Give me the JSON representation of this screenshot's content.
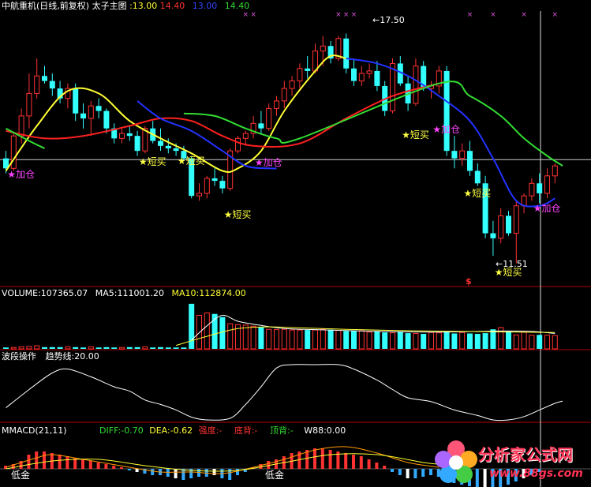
{
  "headers": {
    "main": {
      "title": "中航重机(日线,前复权) 太子主图",
      "v1": ":13.00",
      "v2": "14.40",
      "v3": "13.00",
      "v4": "14.40"
    },
    "volume": {
      "vol": "VOLUME:107365.07",
      "ma5": "MA5:111001.20",
      "ma10": "MA10:112874.00"
    },
    "wave": {
      "name": "波段操作",
      "trend": "趋势线:20.00"
    },
    "macd": {
      "name": "MMACD(21,11)",
      "diff": "DIFF:-0.70",
      "dea": "DEA:-0.62",
      "strength": "强度:-",
      "bottom": "底背:-",
      "top": "顶背:-",
      "w88": "W88:0.00"
    }
  },
  "annotations": {
    "high": "17.50",
    "low": "11.51",
    "low_signal": "低金",
    "s_mark": "$"
  },
  "signals": [
    {
      "label": "加仓",
      "color": "#ff44ff",
      "candle": 1,
      "price": 11.95
    },
    {
      "label": "短买",
      "color": "#ffff44",
      "candle": 18,
      "price": 12.45
    },
    {
      "label": "短买",
      "color": "#ffff44",
      "candle": 23,
      "price": 12.5
    },
    {
      "label": "短买",
      "color": "#ffff44",
      "candle": 29,
      "price": 10.35
    },
    {
      "label": "加仓",
      "color": "#ff44ff",
      "candle": 33,
      "price": 12.42
    },
    {
      "label": "短买",
      "color": "#ffff44",
      "candle": 52,
      "price": 13.55
    },
    {
      "label": "加仓",
      "color": "#ff44ff",
      "candle": 56,
      "price": 13.75
    },
    {
      "label": "短买",
      "color": "#ffff44",
      "candle": 60,
      "price": 11.2
    },
    {
      "label": "短买",
      "color": "#ffff44",
      "candle": 64,
      "price": 8.05
    },
    {
      "label": "加仓",
      "color": "#ff44ff",
      "candle": 69,
      "price": 10.6
    }
  ],
  "watermark": {
    "title": "分析家公式网",
    "url": "www.88gs.com"
  },
  "colors": {
    "up": "#ff3232",
    "down": "#33ffff",
    "ma_short": "#ffff33",
    "ma_mid": "#ff2020",
    "ma_blue": "#2233ff",
    "ma_green": "#33dd33",
    "vol_ma5": "#ffffff",
    "vol_ma10": "#ffff33",
    "panel_border": "#b00000"
  },
  "chart_data": [
    {
      "type": "candlestick",
      "title": "中航重机(日线,前复权) 太子主图",
      "price_range": [
        7.5,
        18.5
      ],
      "reference_line": 12.55,
      "ohlc": [
        [
          12.6,
          12.9,
          12.0,
          12.2
        ],
        [
          12.2,
          13.6,
          12.1,
          13.5
        ],
        [
          13.5,
          14.6,
          13.2,
          14.3
        ],
        [
          14.3,
          16.0,
          13.8,
          15.2
        ],
        [
          15.2,
          16.6,
          15.0,
          15.9
        ],
        [
          15.9,
          16.3,
          15.6,
          15.7
        ],
        [
          15.7,
          16.0,
          15.1,
          15.4
        ],
        [
          15.4,
          15.7,
          14.8,
          15.0
        ],
        [
          15.0,
          15.6,
          14.6,
          15.4
        ],
        [
          15.4,
          15.6,
          14.1,
          14.4
        ],
        [
          14.4,
          14.8,
          13.8,
          14.2
        ],
        [
          14.2,
          14.9,
          13.5,
          14.7
        ],
        [
          14.7,
          15.0,
          14.2,
          14.5
        ],
        [
          14.5,
          14.6,
          13.6,
          13.8
        ],
        [
          13.8,
          14.0,
          13.2,
          13.4
        ],
        [
          13.4,
          13.8,
          13.2,
          13.6
        ],
        [
          13.6,
          13.9,
          13.3,
          13.5
        ],
        [
          13.5,
          13.7,
          12.7,
          12.9
        ],
        [
          12.9,
          13.9,
          12.8,
          13.8
        ],
        [
          13.8,
          14.1,
          13.2,
          13.3
        ],
        [
          13.3,
          13.8,
          12.9,
          13.1
        ],
        [
          13.1,
          13.4,
          12.8,
          13.0
        ],
        [
          13.0,
          13.2,
          12.7,
          12.9
        ],
        [
          12.9,
          13.1,
          12.5,
          12.6
        ],
        [
          12.6,
          12.7,
          11.0,
          11.1
        ],
        [
          11.1,
          11.6,
          10.9,
          11.2
        ],
        [
          11.2,
          11.9,
          11.0,
          11.8
        ],
        [
          11.8,
          12.2,
          11.5,
          11.7
        ],
        [
          11.7,
          11.9,
          11.2,
          11.4
        ],
        [
          11.4,
          13.0,
          11.3,
          12.9
        ],
        [
          12.9,
          13.5,
          12.8,
          13.4
        ],
        [
          13.4,
          13.7,
          13.1,
          13.6
        ],
        [
          13.6,
          14.3,
          13.4,
          14.0
        ],
        [
          14.0,
          14.5,
          13.6,
          13.8
        ],
        [
          13.8,
          14.8,
          13.7,
          14.6
        ],
        [
          14.6,
          15.1,
          14.3,
          14.9
        ],
        [
          14.9,
          15.7,
          14.6,
          15.4
        ],
        [
          15.4,
          15.9,
          15.1,
          15.7
        ],
        [
          15.7,
          16.4,
          15.4,
          16.2
        ],
        [
          16.2,
          16.7,
          15.8,
          16.1
        ],
        [
          16.1,
          17.2,
          16.0,
          16.9
        ],
        [
          16.9,
          17.5,
          16.3,
          17.1
        ],
        [
          17.1,
          17.3,
          16.4,
          16.6
        ],
        [
          16.6,
          17.5,
          16.5,
          17.4
        ],
        [
          17.4,
          17.6,
          16.0,
          16.2
        ],
        [
          16.2,
          16.6,
          15.5,
          15.7
        ],
        [
          15.7,
          16.3,
          15.5,
          16.0
        ],
        [
          16.0,
          16.4,
          15.8,
          16.1
        ],
        [
          16.1,
          16.5,
          15.3,
          15.5
        ],
        [
          15.5,
          15.7,
          14.3,
          14.5
        ],
        [
          14.5,
          16.6,
          14.4,
          16.4
        ],
        [
          16.4,
          16.7,
          15.5,
          15.6
        ],
        [
          15.6,
          15.9,
          14.5,
          14.8
        ],
        [
          14.8,
          16.6,
          14.7,
          16.3
        ],
        [
          16.3,
          16.5,
          15.3,
          15.4
        ],
        [
          15.4,
          15.7,
          15.0,
          15.5
        ],
        [
          15.5,
          16.3,
          15.2,
          16.1
        ],
        [
          16.1,
          16.3,
          12.7,
          12.9
        ],
        [
          12.9,
          13.5,
          12.2,
          12.6
        ],
        [
          12.6,
          13.2,
          12.3,
          12.9
        ],
        [
          12.9,
          13.3,
          11.9,
          12.1
        ],
        [
          12.1,
          12.4,
          11.5,
          11.6
        ],
        [
          11.6,
          11.9,
          9.4,
          9.6
        ],
        [
          9.6,
          10.1,
          8.7,
          9.4
        ],
        [
          9.4,
          10.6,
          9.2,
          10.3
        ],
        [
          10.3,
          10.5,
          9.5,
          9.6
        ],
        [
          9.6,
          10.9,
          8.4,
          10.7
        ],
        [
          10.7,
          11.2,
          10.4,
          11.1
        ],
        [
          11.1,
          11.8,
          10.9,
          11.6
        ],
        [
          11.6,
          12.0,
          10.8,
          11.2
        ],
        [
          11.2,
          12.2,
          11.0,
          11.9
        ],
        [
          11.9,
          12.4,
          11.6,
          12.3
        ]
      ],
      "lines": [
        {
          "color": "#ffff33",
          "points": [
            [
              0,
              12.1
            ],
            [
              4,
              13.9
            ],
            [
              8,
              15.3
            ],
            [
              12,
              15.2
            ],
            [
              16,
              14.1
            ],
            [
              20,
              13.4
            ],
            [
              24,
              12.8
            ],
            [
              28,
              12.1
            ],
            [
              30,
              12.2
            ],
            [
              33,
              12.9
            ],
            [
              36,
              14.5
            ],
            [
              40,
              16.1
            ],
            [
              42,
              16.7
            ],
            [
              44,
              16.6
            ]
          ]
        },
        {
          "color": "#ff2020",
          "points": [
            [
              0,
              13.7
            ],
            [
              5,
              13.4
            ],
            [
              10,
              13.5
            ],
            [
              16,
              13.9
            ],
            [
              20,
              14.2
            ],
            [
              24,
              14.1
            ],
            [
              28,
              13.5
            ],
            [
              32,
              13.1
            ],
            [
              38,
              13.2
            ],
            [
              44,
              14.2
            ],
            [
              50,
              15.1
            ],
            [
              56,
              15.6
            ]
          ]
        },
        {
          "color": "#2233ff",
          "points": [
            [
              17,
              14.9
            ],
            [
              20,
              14.2
            ],
            [
              24,
              13.7
            ],
            [
              28,
              12.9
            ],
            [
              31,
              12.3
            ],
            [
              34,
              12.2
            ],
            [
              35,
              12.2
            ]
          ]
        },
        {
          "color": "#2233ff",
          "points": [
            [
              44,
              16.6
            ],
            [
              48,
              16.4
            ],
            [
              52,
              15.9
            ],
            [
              56,
              15.1
            ],
            [
              60,
              14.1
            ],
            [
              63,
              12.6
            ],
            [
              66,
              10.9
            ],
            [
              69,
              10.7
            ],
            [
              71,
              11.0
            ]
          ]
        },
        {
          "color": "#33dd33",
          "points": [
            [
              0,
              13.8
            ],
            [
              3,
              13.3
            ],
            [
              5,
              13.0
            ]
          ]
        },
        {
          "color": "#33dd33",
          "points": [
            [
              23,
              14.4
            ],
            [
              27,
              14.3
            ],
            [
              31,
              13.8
            ],
            [
              35,
              13.4
            ],
            [
              38,
              13.4
            ],
            [
              56,
              15.6
            ],
            [
              60,
              15.1
            ],
            [
              64,
              14.3
            ],
            [
              67,
              13.4
            ],
            [
              70,
              12.7
            ],
            [
              72,
              12.3
            ]
          ]
        }
      ]
    },
    {
      "type": "bar",
      "title": "VOLUME",
      "ylim": [
        0,
        140000
      ],
      "values": [
        4000,
        4000,
        6000,
        7000,
        9000,
        5000,
        5000,
        5000,
        6000,
        5000,
        4000,
        6000,
        4000,
        5000,
        4000,
        4000,
        5000,
        5000,
        6000,
        4000,
        5000,
        4000,
        4000,
        4000,
        5000,
        5000,
        5000,
        5000,
        5000,
        5000,
        5000,
        5000,
        5000,
        5000,
        5000,
        5000,
        5000,
        5000,
        5000,
        5000,
        5000,
        5000,
        5000,
        5000,
        4000,
        5000,
        5000,
        5000,
        5000,
        5000,
        5000,
        5000,
        5000,
        5000,
        6000,
        5000,
        6000,
        5000,
        6000,
        6000,
        6000,
        6000,
        7000,
        8000,
        6000,
        6000,
        6000,
        7000,
        7000,
        7000,
        7000,
        7000
      ],
      "overrides": {
        "24": 129000,
        "25": 96000,
        "26": 103000,
        "27": 100000,
        "28": 91000,
        "29": 72000,
        "30": 69000,
        "31": 68000,
        "32": 65000,
        "33": 62000,
        "34": 56000,
        "35": 55000,
        "36": 56000,
        "37": 54000,
        "38": 54000,
        "39": 54000,
        "40": 54000,
        "41": 56000,
        "42": 55000,
        "43": 53000,
        "44": 51000,
        "45": 52000,
        "46": 52000,
        "47": 48000,
        "48": 51000,
        "49": 47000,
        "50": 46000,
        "51": 49000,
        "52": 45000,
        "53": 44000,
        "54": 43000,
        "55": 47000,
        "56": 46000,
        "57": 50000,
        "58": 44000,
        "59": 47000,
        "60": 44000,
        "61": 43000,
        "62": 45000,
        "63": 56000,
        "64": 61000,
        "65": 51000,
        "66": 40000,
        "67": 48000,
        "68": 39000,
        "69": 40000,
        "70": 39000,
        "71": 38000
      },
      "ma5": [
        [
          24,
          25000
        ],
        [
          26,
          66000
        ],
        [
          28,
          96000
        ],
        [
          30,
          79000
        ],
        [
          33,
          67000
        ],
        [
          36,
          58000
        ],
        [
          40,
          55000
        ],
        [
          48,
          50000
        ],
        [
          56,
          48000
        ],
        [
          64,
          51000
        ],
        [
          68,
          50000
        ],
        [
          71,
          44000
        ]
      ],
      "ma10": [
        [
          22,
          10000
        ],
        [
          26,
          36000
        ],
        [
          30,
          58000
        ],
        [
          34,
          63000
        ],
        [
          38,
          60000
        ],
        [
          44,
          56000
        ],
        [
          52,
          52000
        ],
        [
          62,
          49000
        ],
        [
          71,
          47000
        ]
      ]
    },
    {
      "type": "line",
      "title": "波段操作",
      "ylim": [
        0,
        100
      ],
      "points": [
        [
          0,
          22
        ],
        [
          3,
          55
        ],
        [
          6,
          85
        ],
        [
          8,
          92
        ],
        [
          11,
          78
        ],
        [
          14,
          60
        ],
        [
          16,
          52
        ],
        [
          18,
          36
        ],
        [
          20,
          28
        ],
        [
          22,
          18
        ],
        [
          24,
          5
        ],
        [
          26,
          0
        ],
        [
          29,
          3
        ],
        [
          31,
          28
        ],
        [
          33,
          60
        ],
        [
          35,
          94
        ],
        [
          37,
          100
        ],
        [
          40,
          100
        ],
        [
          43,
          100
        ],
        [
          45,
          92
        ],
        [
          48,
          72
        ],
        [
          50,
          55
        ],
        [
          52,
          40
        ],
        [
          55,
          33
        ],
        [
          58,
          18
        ],
        [
          61,
          8
        ],
        [
          63,
          0
        ],
        [
          65,
          0
        ],
        [
          67,
          6
        ],
        [
          69,
          18
        ],
        [
          71,
          30
        ],
        [
          72,
          34
        ]
      ]
    },
    {
      "type": "bar",
      "title": "MMACD(21,11)",
      "ylim": [
        -1,
        1
      ],
      "values": [
        0.1,
        0.15,
        0.25,
        0.45,
        0.55,
        0.55,
        0.5,
        0.45,
        0.4,
        0.35,
        0.3,
        0.25,
        0.2,
        0.15,
        0.1,
        0.05,
        -0.05,
        -0.1,
        -0.15,
        -0.2,
        -0.2,
        -0.25,
        -0.3,
        -0.35,
        -0.3,
        -0.25,
        -0.25,
        -0.2,
        -0.3,
        -0.35,
        -0.2,
        -0.1,
        0.05,
        0.15,
        0.25,
        0.3,
        0.4,
        0.5,
        0.55,
        0.6,
        0.65,
        0.65,
        0.6,
        0.55,
        0.5,
        0.45,
        0.4,
        0.3,
        0.2,
        0.1,
        -0.1,
        -0.2,
        -0.3,
        -0.3,
        -0.25,
        -0.2,
        -0.25,
        -0.3,
        -0.45,
        -0.5,
        -0.55,
        -0.65,
        -0.7,
        -0.7,
        -0.6,
        -0.5,
        -0.4,
        -0.3,
        -0.2,
        -0.1,
        0.0,
        0.0
      ],
      "diff": [
        [
          0,
          0.05
        ],
        [
          4,
          0.35
        ],
        [
          6,
          0.45
        ],
        [
          10,
          0.3
        ],
        [
          16,
          0.05
        ],
        [
          20,
          -0.1
        ],
        [
          24,
          -0.1
        ],
        [
          28,
          -0.15
        ],
        [
          32,
          0.05
        ],
        [
          36,
          0.3
        ],
        [
          40,
          0.6
        ],
        [
          44,
          0.7
        ],
        [
          48,
          0.5
        ],
        [
          52,
          0.2
        ],
        [
          56,
          0.05
        ]
      ],
      "dea": [
        [
          0,
          0.0
        ],
        [
          6,
          0.25
        ],
        [
          12,
          0.3
        ],
        [
          18,
          0.1
        ],
        [
          24,
          -0.05
        ],
        [
          30,
          -0.05
        ],
        [
          36,
          0.2
        ],
        [
          42,
          0.45
        ],
        [
          48,
          0.45
        ],
        [
          54,
          0.2
        ],
        [
          56,
          0.15
        ]
      ]
    }
  ]
}
